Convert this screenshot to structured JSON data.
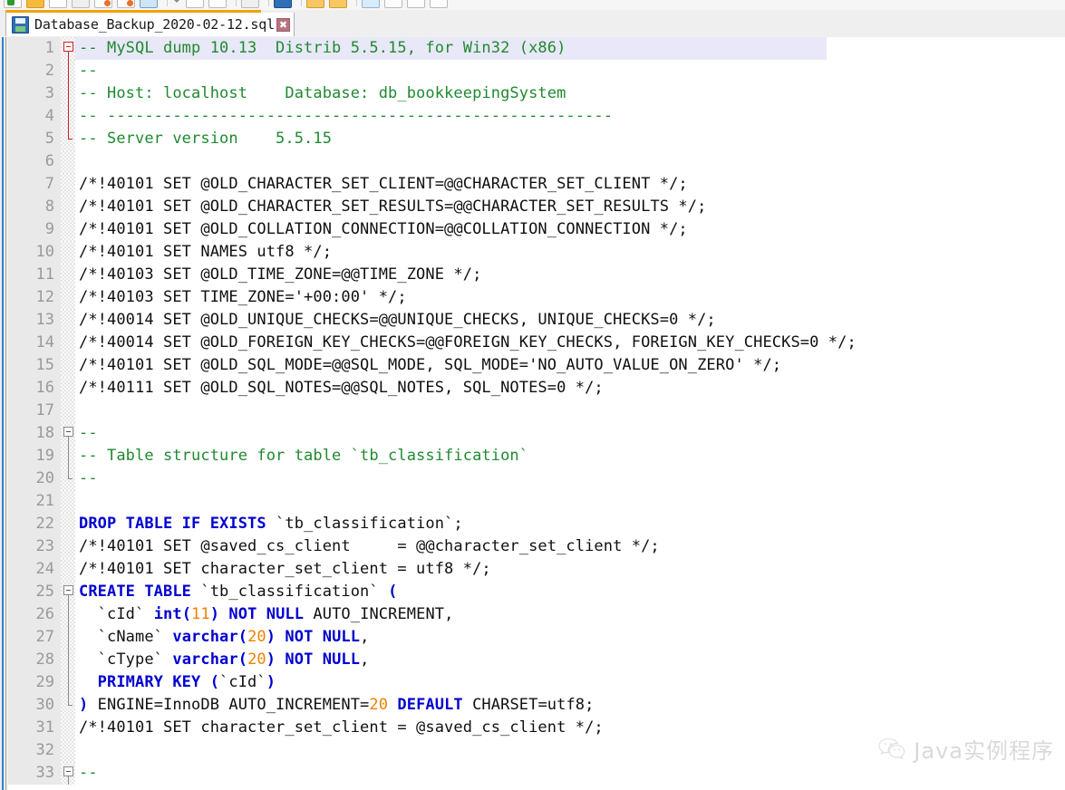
{
  "toolbar": {
    "name": "editor-toolbar",
    "icons": [
      "new-file-icon",
      "open-folder-icon",
      "save-icon",
      "save-all-icon",
      "close-icon",
      "close-all-icon",
      "print-icon",
      "cut-icon",
      "copy-icon",
      "paste-icon",
      "undo-icon",
      "redo-icon",
      "find-icon",
      "zoom-in-icon",
      "zoom-out-icon",
      "word-wrap-icon",
      "show-symbol-icon",
      "macro-record-icon",
      "run-icon"
    ]
  },
  "tab": {
    "title": "Database_Backup_2020-02-12.sql",
    "close_label": "✖",
    "icon": "save-file-icon"
  },
  "watermark": {
    "text": "Java实例程序",
    "icon": "wechat-icon"
  },
  "colors": {
    "comment": "#1f8a2f",
    "keyword": "#0000d0",
    "number": "#f08000",
    "text": "#101010",
    "highlight_line": "#e8e8f8",
    "tab_accent": "#f0a30a",
    "gutter_bg": "#e9e9e9"
  },
  "editor": {
    "current_line": 1,
    "lines": [
      {
        "n": "1",
        "fold": "start-red",
        "hl": true,
        "tokens": [
          {
            "t": "-- MySQL dump 10.13  Distrib 5.5.15, for Win32 (x86)",
            "c": "cmt"
          }
        ]
      },
      {
        "n": "2",
        "fold": "bar-red",
        "tokens": [
          {
            "t": "--",
            "c": "cmt"
          }
        ]
      },
      {
        "n": "3",
        "fold": "bar-red",
        "tokens": [
          {
            "t": "-- Host: localhost    Database: db_bookkeepingSystem",
            "c": "cmt"
          }
        ]
      },
      {
        "n": "4",
        "fold": "bar-red",
        "tokens": [
          {
            "t": "-- ------------------------------------------------------",
            "c": "cmt"
          }
        ]
      },
      {
        "n": "5",
        "fold": "end-red",
        "tokens": [
          {
            "t": "-- Server version\t5.5.15",
            "c": "cmt"
          }
        ]
      },
      {
        "n": "6",
        "fold": "none",
        "tokens": []
      },
      {
        "n": "7",
        "fold": "none",
        "tokens": [
          {
            "t": "/*!40101 SET @OLD_CHARACTER_SET_CLIENT=@@CHARACTER_SET_CLIENT */;",
            "c": "txt"
          }
        ]
      },
      {
        "n": "8",
        "fold": "none",
        "tokens": [
          {
            "t": "/*!40101 SET @OLD_CHARACTER_SET_RESULTS=@@CHARACTER_SET_RESULTS */;",
            "c": "txt"
          }
        ]
      },
      {
        "n": "9",
        "fold": "none",
        "tokens": [
          {
            "t": "/*!40101 SET @OLD_COLLATION_CONNECTION=@@COLLATION_CONNECTION */;",
            "c": "txt"
          }
        ]
      },
      {
        "n": "10",
        "fold": "none",
        "tokens": [
          {
            "t": "/*!40101 SET NAMES utf8 */;",
            "c": "txt"
          }
        ]
      },
      {
        "n": "11",
        "fold": "none",
        "tokens": [
          {
            "t": "/*!40103 SET @OLD_TIME_ZONE=@@TIME_ZONE */;",
            "c": "txt"
          }
        ]
      },
      {
        "n": "12",
        "fold": "none",
        "tokens": [
          {
            "t": "/*!40103 SET TIME_ZONE='+00:00' */;",
            "c": "txt"
          }
        ]
      },
      {
        "n": "13",
        "fold": "none",
        "tokens": [
          {
            "t": "/*!40014 SET @OLD_UNIQUE_CHECKS=@@UNIQUE_CHECKS, UNIQUE_CHECKS=0 */;",
            "c": "txt"
          }
        ]
      },
      {
        "n": "14",
        "fold": "none",
        "tokens": [
          {
            "t": "/*!40014 SET @OLD_FOREIGN_KEY_CHECKS=@@FOREIGN_KEY_CHECKS, FOREIGN_KEY_CHECKS=0 */;",
            "c": "txt"
          }
        ]
      },
      {
        "n": "15",
        "fold": "none",
        "tokens": [
          {
            "t": "/*!40101 SET @OLD_SQL_MODE=@@SQL_MODE, SQL_MODE='NO_AUTO_VALUE_ON_ZERO' */;",
            "c": "txt"
          }
        ]
      },
      {
        "n": "16",
        "fold": "none",
        "tokens": [
          {
            "t": "/*!40111 SET @OLD_SQL_NOTES=@@SQL_NOTES, SQL_NOTES=0 */;",
            "c": "txt"
          }
        ]
      },
      {
        "n": "17",
        "fold": "none",
        "tokens": []
      },
      {
        "n": "18",
        "fold": "start-gray",
        "tokens": [
          {
            "t": "--",
            "c": "cmt"
          }
        ]
      },
      {
        "n": "19",
        "fold": "bar-gray",
        "tokens": [
          {
            "t": "-- Table structure for table `tb_classification`",
            "c": "cmt"
          }
        ]
      },
      {
        "n": "20",
        "fold": "end-gray",
        "tokens": [
          {
            "t": "--",
            "c": "cmt"
          }
        ]
      },
      {
        "n": "21",
        "fold": "none",
        "tokens": []
      },
      {
        "n": "22",
        "fold": "none",
        "tokens": [
          {
            "t": "DROP TABLE IF EXISTS",
            "c": "kw"
          },
          {
            "t": " `tb_classification`;",
            "c": "txt"
          }
        ]
      },
      {
        "n": "23",
        "fold": "none",
        "tokens": [
          {
            "t": "/*!40101 SET @saved_cs_client     = @@character_set_client */;",
            "c": "txt"
          }
        ]
      },
      {
        "n": "24",
        "fold": "none",
        "tokens": [
          {
            "t": "/*!40101 SET character_set_client = utf8 */;",
            "c": "txt"
          }
        ]
      },
      {
        "n": "25",
        "fold": "start-gray",
        "tokens": [
          {
            "t": "CREATE TABLE",
            "c": "kw"
          },
          {
            "t": " `tb_classification` ",
            "c": "txt"
          },
          {
            "t": "(",
            "c": "kw"
          }
        ]
      },
      {
        "n": "26",
        "fold": "bar-gray",
        "tokens": [
          {
            "t": "  `cId` ",
            "c": "txt"
          },
          {
            "t": "int",
            "c": "kw"
          },
          {
            "t": "(",
            "c": "kw"
          },
          {
            "t": "11",
            "c": "num"
          },
          {
            "t": ")",
            "c": "kw"
          },
          {
            "t": " ",
            "c": "txt"
          },
          {
            "t": "NOT NULL",
            "c": "kw"
          },
          {
            "t": " AUTO_INCREMENT,",
            "c": "txt"
          }
        ]
      },
      {
        "n": "27",
        "fold": "bar-gray",
        "tokens": [
          {
            "t": "  `cName` ",
            "c": "txt"
          },
          {
            "t": "varchar",
            "c": "kw"
          },
          {
            "t": "(",
            "c": "kw"
          },
          {
            "t": "20",
            "c": "num"
          },
          {
            "t": ")",
            "c": "kw"
          },
          {
            "t": " ",
            "c": "txt"
          },
          {
            "t": "NOT NULL",
            "c": "kw"
          },
          {
            "t": ",",
            "c": "txt"
          }
        ]
      },
      {
        "n": "28",
        "fold": "bar-gray",
        "tokens": [
          {
            "t": "  `cType` ",
            "c": "txt"
          },
          {
            "t": "varchar",
            "c": "kw"
          },
          {
            "t": "(",
            "c": "kw"
          },
          {
            "t": "20",
            "c": "num"
          },
          {
            "t": ")",
            "c": "kw"
          },
          {
            "t": " ",
            "c": "txt"
          },
          {
            "t": "NOT NULL",
            "c": "kw"
          },
          {
            "t": ",",
            "c": "txt"
          }
        ]
      },
      {
        "n": "29",
        "fold": "bar-gray",
        "tokens": [
          {
            "t": "  ",
            "c": "txt"
          },
          {
            "t": "PRIMARY KEY",
            "c": "kw"
          },
          {
            "t": " ",
            "c": "txt"
          },
          {
            "t": "(",
            "c": "kw"
          },
          {
            "t": "`cId`",
            "c": "txt"
          },
          {
            "t": ")",
            "c": "kw"
          }
        ]
      },
      {
        "n": "30",
        "fold": "end-gray",
        "tokens": [
          {
            "t": ")",
            "c": "kw"
          },
          {
            "t": " ENGINE=InnoDB AUTO_INCREMENT=",
            "c": "txt"
          },
          {
            "t": "20",
            "c": "num"
          },
          {
            "t": " ",
            "c": "txt"
          },
          {
            "t": "DEFAULT",
            "c": "kw"
          },
          {
            "t": " CHARSET=utf8;",
            "c": "txt"
          }
        ]
      },
      {
        "n": "31",
        "fold": "none",
        "tokens": [
          {
            "t": "/*!40101 SET character_set_client = @saved_cs_client */;",
            "c": "txt"
          }
        ]
      },
      {
        "n": "32",
        "fold": "none",
        "tokens": []
      },
      {
        "n": "33",
        "fold": "start-gray",
        "tokens": [
          {
            "t": "--",
            "c": "cmt"
          }
        ]
      }
    ]
  }
}
